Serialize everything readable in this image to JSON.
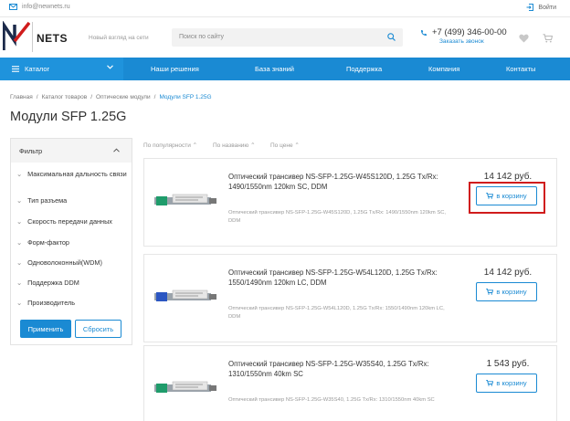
{
  "topbar": {
    "email": "info@newnets.ru",
    "login_label": "Войти"
  },
  "header": {
    "logo_text": "NETS",
    "tagline": "Новый взгляд на сети",
    "search_placeholder": "Поиск по сайту",
    "phone": "+7 (499) 346-00-00",
    "callback": "Заказать звонок"
  },
  "nav": {
    "catalog_label": "Каталог",
    "items": [
      "Наши решения",
      "База знаний",
      "Поддержка",
      "Компания",
      "Контакты"
    ]
  },
  "breadcrumbs": [
    "Главная",
    "/",
    "Каталог товаров",
    "/",
    "Оптические модули",
    "/",
    "Модули SFP 1.25G"
  ],
  "page_title": "Модули SFP 1.25G",
  "filter": {
    "title": "Фильтр",
    "items": [
      "Максимальная дальность связи",
      "Тип разъема",
      "Скорость передачи данных",
      "Форм-фактор",
      "Одноволоконный(WDM)",
      "Поддержка DDM",
      "Производитель"
    ],
    "apply_label": "Применить",
    "reset_label": "Сбросить"
  },
  "sort": [
    "По популярности",
    "По названию",
    "По цене"
  ],
  "products": [
    {
      "name": "Оптический трансивер NS-SFP-1.25G-W45S120D, 1.25G Tx/Rx: 1490/1550nm 120km SC, DDM",
      "desc": "Оптический трансивер NS-SFP-1.25G-W45S120D, 1.25G Tx/Rx: 1490/1550nm 120km SC, DDM",
      "price": "14 142 руб.",
      "buy_label": "в корзину"
    },
    {
      "name": "Оптический трансивер NS-SFP-1.25G-W54L120D, 1.25G Tx/Rx: 1550/1490nm 120km LC, DDM",
      "desc": "Оптический трансивер NS-SFP-1.25G-W54L120D, 1.25G Tx/Rx: 1550/1490nm 120km LC, DDM",
      "price": "14 142 руб.",
      "buy_label": "в корзину"
    },
    {
      "name": "Оптический трансивер NS-SFP-1.25G-W35S40, 1.25G Tx/Rx: 1310/1550nm 40km SC",
      "desc": "Оптический трансивер NS-SFP-1.25G-W35S40, 1.25G Tx/Rx: 1310/1550nm 40km SC",
      "price": "1 543 руб.",
      "buy_label": "в корзину"
    }
  ],
  "colors": {
    "accent": "#1a8ad3",
    "highlight": "#d01c1c"
  }
}
